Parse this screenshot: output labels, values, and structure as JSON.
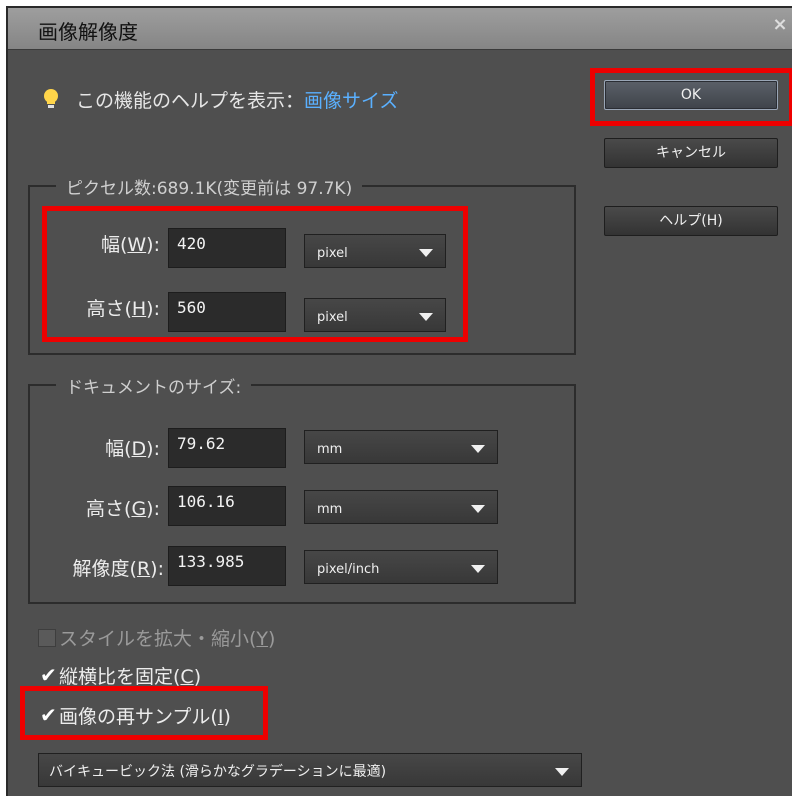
{
  "dialog": {
    "title": "画像解像度",
    "close_glyph": "×"
  },
  "help": {
    "prefix": "この機能のヘルプを表示：",
    "link": "画像サイズ",
    "icon": "lightbulb-icon"
  },
  "buttons": {
    "ok": "OK",
    "cancel": "キャンセル",
    "help": "ヘルプ(H)"
  },
  "pixel_dimensions": {
    "legend": "ピクセル数:689.1K(変更前は 97.7K)",
    "width_label": "幅(",
    "width_key": "W",
    "width_value": "420",
    "width_unit": "pixel",
    "height_label": "高さ(",
    "height_key": "H",
    "height_value": "560",
    "height_unit": "pixel"
  },
  "document_size": {
    "legend": "ドキュメントのサイズ:",
    "width_label": "幅(",
    "width_key": "D",
    "width_value": "79.62",
    "width_unit": "mm",
    "height_label": "高さ(",
    "height_key": "G",
    "height_value": "106.16",
    "height_unit": "mm",
    "resolution_label": "解像度(",
    "resolution_key": "R",
    "resolution_value": "133.985",
    "resolution_unit": "pixel/inch"
  },
  "options": {
    "scale_styles": {
      "label": "スタイルを拡大・縮小(",
      "key": "Y",
      "checked": false
    },
    "constrain": {
      "label": "縦横比を固定(",
      "key": "C",
      "checked": true
    },
    "resample": {
      "label": "画像の再サンプル(",
      "key": "I",
      "checked": true
    },
    "method": "バイキュービック法 (滑らかなグラデーションに最適)"
  },
  "label_suffix": "):",
  "label_suffix_plain": ")",
  "check_glyph": "✔",
  "colors": {
    "highlight": "#ee0000",
    "link": "#5ab0ff",
    "panel": "#4f4f4f"
  }
}
